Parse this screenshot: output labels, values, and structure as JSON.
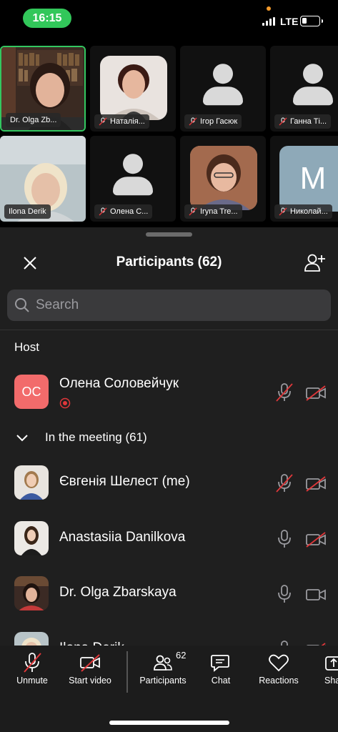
{
  "status_bar": {
    "time": "16:15",
    "network": "LTE",
    "battery_level": 0.2
  },
  "video_tiles": [
    {
      "name": "Dr. Olga Zb...",
      "kind": "photo",
      "active": true,
      "muted": false
    },
    {
      "name": "Наталія...",
      "kind": "photo",
      "active": false,
      "muted": true
    },
    {
      "name": "Ігор Гасюк",
      "kind": "silhouette",
      "active": false,
      "muted": true
    },
    {
      "name": "Ганна Ті...",
      "kind": "silhouette",
      "active": false,
      "muted": true
    },
    {
      "name": "Ilona Derik",
      "kind": "photo",
      "active": false,
      "muted": false
    },
    {
      "name": "Олена С...",
      "kind": "silhouette",
      "active": false,
      "muted": true
    },
    {
      "name": "Iryna Tre...",
      "kind": "photo",
      "active": false,
      "muted": true
    },
    {
      "name": "Николай...",
      "kind": "letter",
      "letter": "M",
      "active": false,
      "muted": true
    }
  ],
  "panel": {
    "title": "Participants (62)",
    "search_placeholder": "Search",
    "host_section": "Host",
    "host": {
      "name": "Олена Соловейчук",
      "initials": "OC",
      "mic": "muted",
      "video": "off",
      "recording": true
    },
    "group_label": "In the meeting (61)",
    "participants": [
      {
        "name": "Євгенія Шелест (me)",
        "mic": "muted",
        "video": "off"
      },
      {
        "name": "Anastasiia Danilkova",
        "mic": "on",
        "video": "off"
      },
      {
        "name": "Dr. Olga Zbarskaya",
        "mic": "on",
        "video": "on"
      },
      {
        "name": "Ilona Derik",
        "mic": "on",
        "video": "off"
      }
    ]
  },
  "toolbar": {
    "unmute": "Unmute",
    "start_video": "Start video",
    "participants": "Participants",
    "participants_count": "62",
    "chat": "Chat",
    "reactions": "Reactions",
    "share": "Share"
  },
  "colors": {
    "accent_green": "#33c760",
    "muted_red": "#e0373a",
    "host_avatar": "#f26b6b"
  }
}
